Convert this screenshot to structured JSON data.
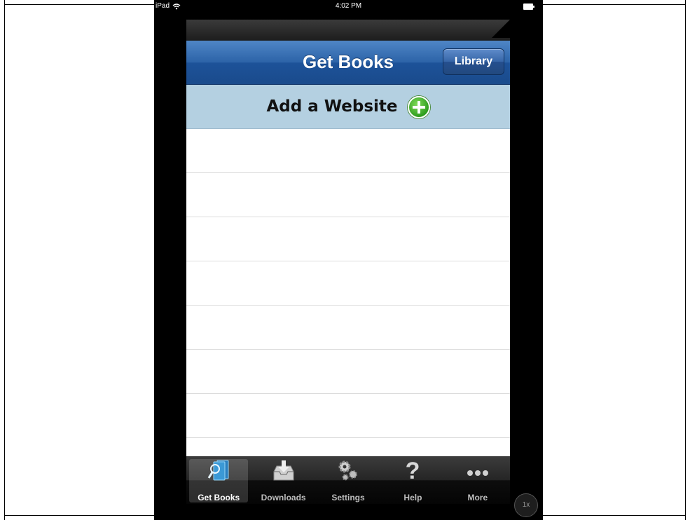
{
  "statusbar": {
    "device": "iPad",
    "time": "4:02 PM"
  },
  "navbar": {
    "title": "Get Books",
    "library_button": "Library"
  },
  "add_website": {
    "label": "Add a Website"
  },
  "list_rows": 8,
  "tabs": [
    {
      "label": "Get Books",
      "icon": "get-books-icon",
      "active": true
    },
    {
      "label": "Downloads",
      "icon": "downloads-icon",
      "active": false
    },
    {
      "label": "Settings",
      "icon": "settings-icon",
      "active": false
    },
    {
      "label": "Help",
      "icon": "help-icon",
      "active": false
    },
    {
      "label": "More",
      "icon": "more-icon",
      "active": false
    }
  ],
  "zoom_badge": "1x",
  "colors": {
    "navbar": "#2c63a8",
    "add_row": "#b4d0e1",
    "plus": "#2f9e1f"
  }
}
